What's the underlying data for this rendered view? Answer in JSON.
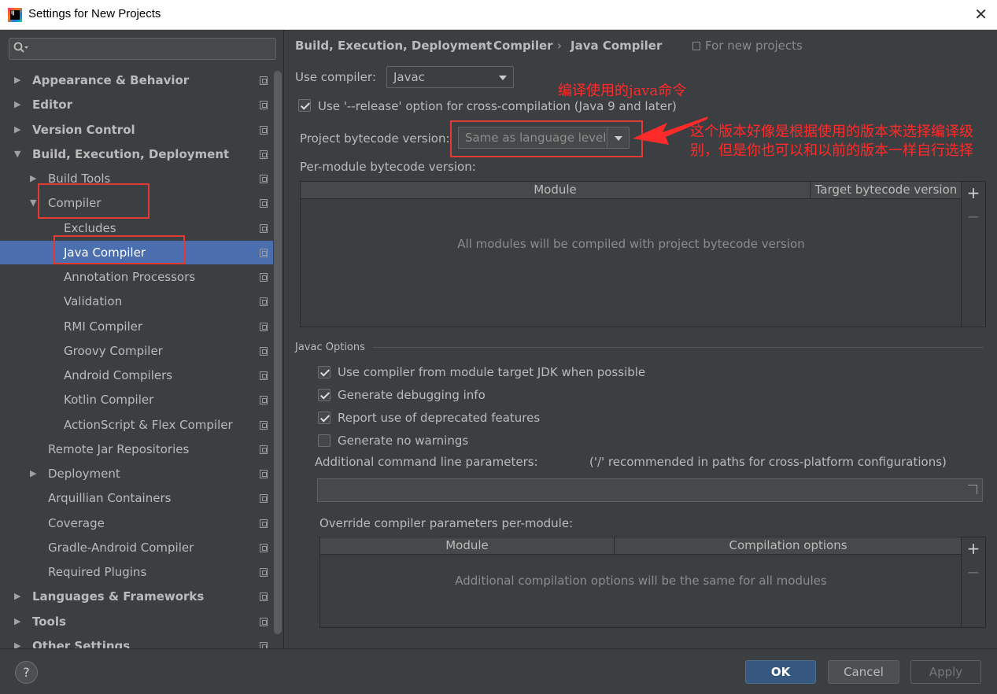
{
  "window": {
    "title": "Settings for New Projects",
    "close": "✕"
  },
  "search": {
    "placeholder": "",
    "icon": "search-icon"
  },
  "tree": [
    {
      "label": "Appearance & Behavior",
      "bold": true,
      "arrow": "▶",
      "level": 0
    },
    {
      "label": "Editor",
      "bold": true,
      "arrow": "▶",
      "level": 0
    },
    {
      "label": "Version Control",
      "bold": true,
      "arrow": "▶",
      "level": 0
    },
    {
      "label": "Build, Execution, Deployment",
      "bold": true,
      "arrow": "▼",
      "level": 0
    },
    {
      "label": "Build Tools",
      "bold": false,
      "arrow": "▶",
      "level": 1
    },
    {
      "label": "Compiler",
      "bold": false,
      "arrow": "▼",
      "level": 1
    },
    {
      "label": "Excludes",
      "bold": false,
      "arrow": "",
      "level": 2
    },
    {
      "label": "Java Compiler",
      "bold": false,
      "arrow": "",
      "level": 2,
      "selected": true
    },
    {
      "label": "Annotation Processors",
      "bold": false,
      "arrow": "",
      "level": 2
    },
    {
      "label": "Validation",
      "bold": false,
      "arrow": "",
      "level": 2
    },
    {
      "label": "RMI Compiler",
      "bold": false,
      "arrow": "",
      "level": 2
    },
    {
      "label": "Groovy Compiler",
      "bold": false,
      "arrow": "",
      "level": 2
    },
    {
      "label": "Android Compilers",
      "bold": false,
      "arrow": "",
      "level": 2
    },
    {
      "label": "Kotlin Compiler",
      "bold": false,
      "arrow": "",
      "level": 2
    },
    {
      "label": "ActionScript & Flex Compiler",
      "bold": false,
      "arrow": "",
      "level": 2
    },
    {
      "label": "Remote Jar Repositories",
      "bold": false,
      "arrow": "",
      "level": 1
    },
    {
      "label": "Deployment",
      "bold": false,
      "arrow": "▶",
      "level": 1
    },
    {
      "label": "Arquillian Containers",
      "bold": false,
      "arrow": "",
      "level": 1
    },
    {
      "label": "Coverage",
      "bold": false,
      "arrow": "",
      "level": 1
    },
    {
      "label": "Gradle-Android Compiler",
      "bold": false,
      "arrow": "",
      "level": 1
    },
    {
      "label": "Required Plugins",
      "bold": false,
      "arrow": "",
      "level": 1
    },
    {
      "label": "Languages & Frameworks",
      "bold": true,
      "arrow": "▶",
      "level": 0
    },
    {
      "label": "Tools",
      "bold": true,
      "arrow": "▶",
      "level": 0
    },
    {
      "label": "Other Settings",
      "bold": true,
      "arrow": "▶",
      "level": 0
    }
  ],
  "breadcrumb": {
    "items": [
      "Build, Execution, Deployment",
      "Compiler",
      "Java Compiler"
    ],
    "separator": "›",
    "scope": "For new projects"
  },
  "compiler": {
    "use_compiler_label": "Use compiler:",
    "use_compiler_value": "Javac",
    "release_option_label": "Use '--release' option for cross-compilation (Java 9 and later)",
    "release_option_checked": true,
    "bytecode_label": "Project bytecode version:",
    "bytecode_value": "Same as language level",
    "per_module_label": "Per-module bytecode version:"
  },
  "module_table": {
    "columns": [
      "Module",
      "Target bytecode version"
    ],
    "empty_text": "All modules will be compiled with project bytecode version",
    "add": "+",
    "remove": "−"
  },
  "javac_options": {
    "section_title": "Javac Options",
    "checkboxes": [
      {
        "label": "Use compiler from module target JDK when possible",
        "checked": true
      },
      {
        "label": "Generate debugging info",
        "checked": true
      },
      {
        "label": "Report use of deprecated features",
        "checked": true
      },
      {
        "label": "Generate no warnings",
        "checked": false
      }
    ],
    "additional_params_label": "Additional command line parameters:",
    "additional_params_hint": "('/' recommended in paths for cross-platform configurations)",
    "additional_params_value": "",
    "override_label": "Override compiler parameters per-module:"
  },
  "override_table": {
    "columns": [
      "Module",
      "Compilation options"
    ],
    "empty_text": "Additional compilation options will be the same for all modules",
    "add": "+",
    "remove": "−"
  },
  "annotations": {
    "note1": "编译使用的java命令",
    "note2": "这个版本好像是根据使用的版本来选择编译级别，但是你也可以和以前的版本一样自行选择",
    "color": "#ff2a2a"
  },
  "footer": {
    "help": "?",
    "ok": "OK",
    "cancel": "Cancel",
    "apply": "Apply"
  },
  "colors": {
    "background": "#3c3f41",
    "selection": "#4b6eaf",
    "ok_button": "#365880"
  }
}
